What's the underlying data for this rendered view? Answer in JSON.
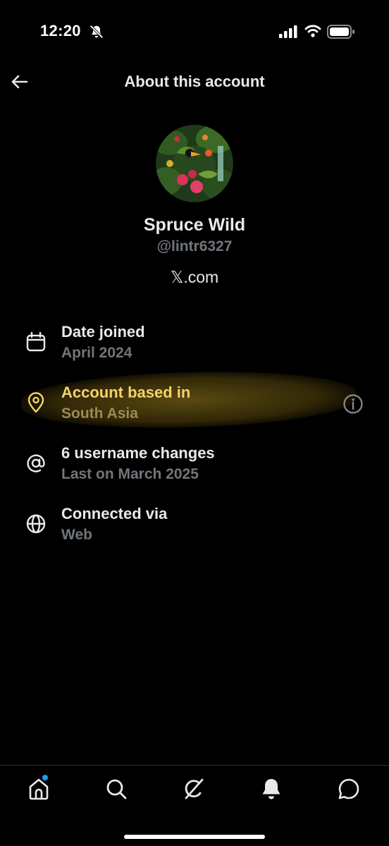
{
  "status_bar": {
    "time": "12:20",
    "icons": [
      "bell-off-icon",
      "signal-icon",
      "wifi-icon",
      "battery-icon"
    ]
  },
  "header": {
    "title": "About this account",
    "back_icon": "back-arrow-icon"
  },
  "profile": {
    "name": "Spruce Wild",
    "handle": "@lintr6327",
    "site": "𝕏.com"
  },
  "details": [
    {
      "icon": "calendar-icon",
      "label": "Date joined",
      "value": "April 2024"
    },
    {
      "icon": "location-pin-icon",
      "label": "Account based in",
      "value": "South Asia",
      "highlighted": true,
      "action_icon": "info-icon"
    },
    {
      "icon": "at-sign-icon",
      "label": "6 username changes",
      "value": "Last on March 2025"
    },
    {
      "icon": "globe-icon",
      "label": "Connected via",
      "value": "Web"
    }
  ],
  "tab_bar": {
    "items": [
      "home-icon",
      "search-icon",
      "grok-icon",
      "notifications-icon",
      "messages-icon"
    ],
    "home_has_badge": true
  },
  "colors": {
    "background": "#000000",
    "text_primary": "#e7e9ea",
    "text_secondary": "#71767b",
    "highlight_text": "#f5d26b",
    "accent": "#1d9bf0"
  }
}
